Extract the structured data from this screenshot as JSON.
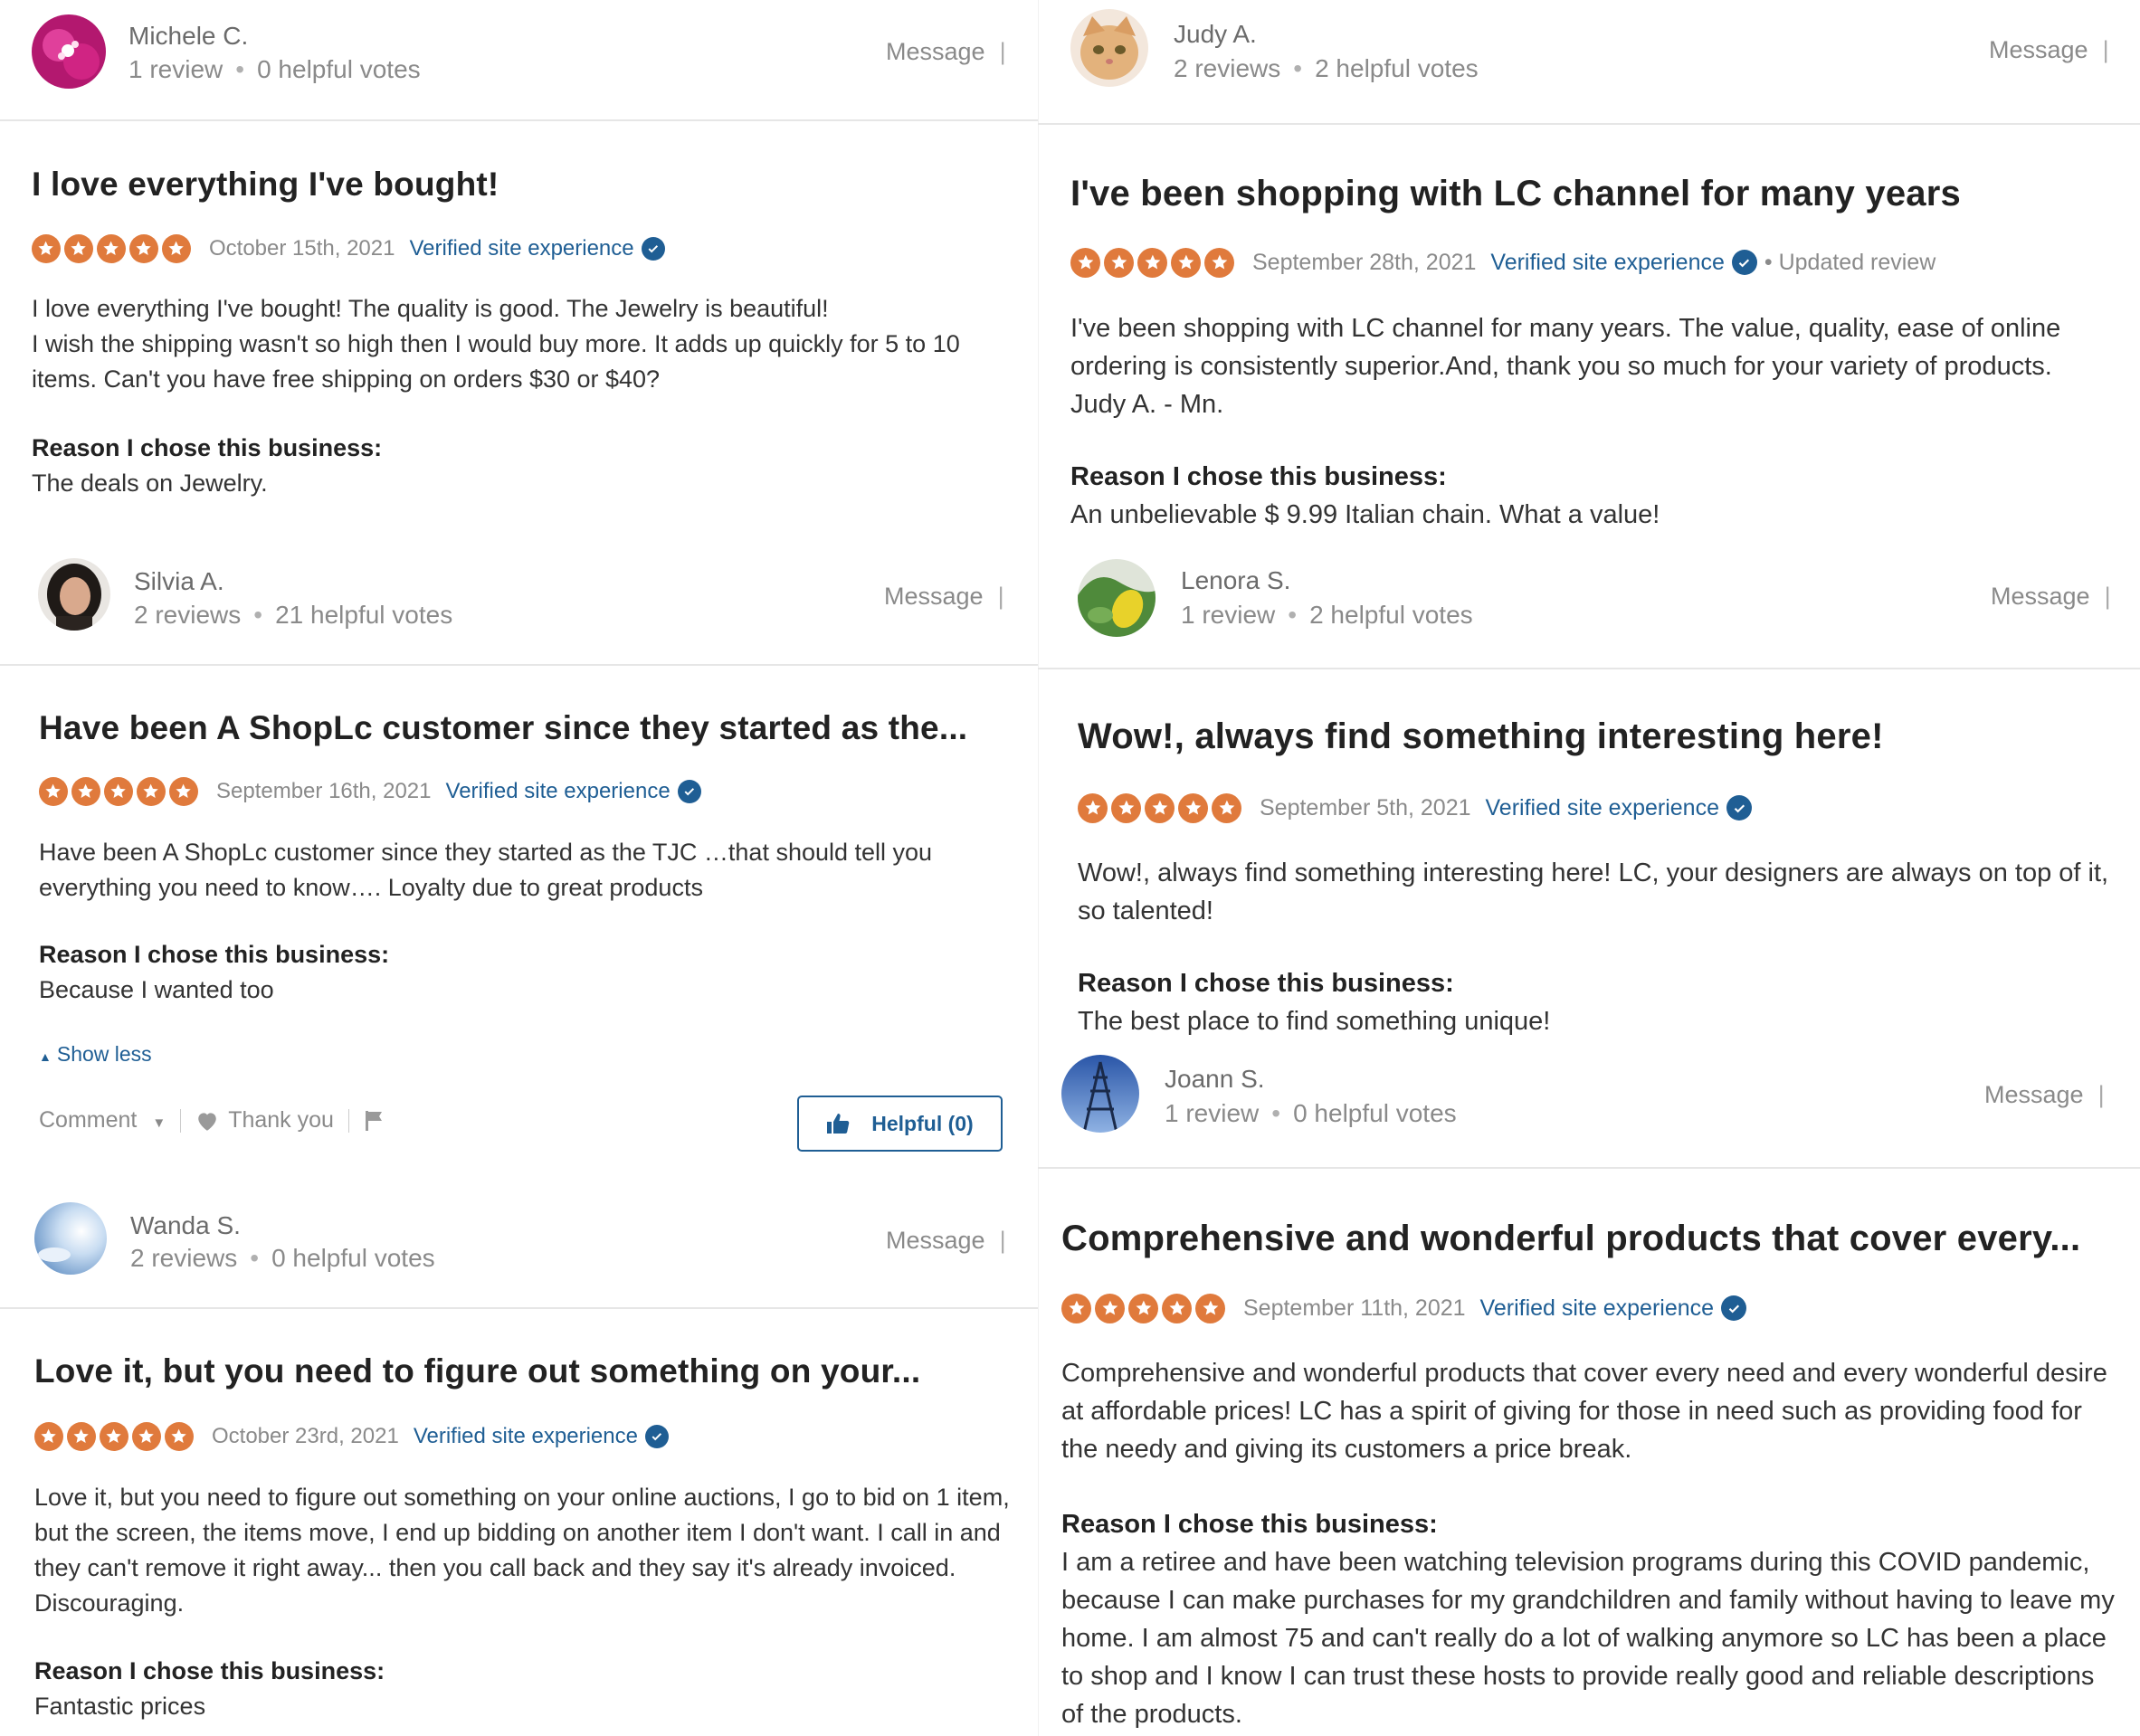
{
  "common": {
    "message_label": "Message",
    "verified_label": "Verified site experience",
    "reason_heading": "Reason I chose this business:",
    "star_color": "#e07a3c",
    "link_color": "#1f5e94"
  },
  "left": [
    {
      "reviewer": {
        "name": "Michele C.",
        "reviews": "1 review",
        "votes": "0 helpful votes",
        "avatar": "pink-flower"
      },
      "title": "I love everything I've bought!",
      "rating": 5,
      "date": "October 15th, 2021",
      "body_lines": [
        "I love everything I've bought! The quality is good. The Jewelry is beautiful!",
        "I wish the shipping wasn't so high then I would buy more. It adds up quickly for 5 to 10",
        "items. Can't you have free shipping on orders $30 or $40?"
      ],
      "reason": "The deals on Jewelry."
    },
    {
      "reviewer": {
        "name": "Silvia A.",
        "reviews": "2 reviews",
        "votes": "21 helpful votes",
        "avatar": "woman-portrait"
      },
      "title": "Have been A ShopLc customer since they started as the...",
      "rating": 5,
      "date": "September 16th, 2021",
      "body_lines": [
        "Have been A ShopLc customer since they started as the TJC …that should tell you",
        "everything you need to know…. Loyalty due to great products"
      ],
      "reason": "Because I wanted too",
      "show_less": "Show less",
      "actions": {
        "comment": "Comment",
        "thank_you": "Thank you",
        "helpful": "Helpful (0)"
      }
    },
    {
      "reviewer": {
        "name": "Wanda S.",
        "reviews": "2 reviews",
        "votes": "0 helpful votes",
        "avatar": "sky-clouds"
      },
      "title": "Love it, but you need to figure out something on your...",
      "rating": 5,
      "date": "October 23rd, 2021",
      "body_lines": [
        "Love it, but you need to figure out something on your online auctions, I go to bid on 1 item,",
        "but the screen, the items move, I end up bidding on another item I don't want. I call in and",
        "they can't remove it right away... then you call back and they say it's already invoiced.",
        "Discouraging."
      ],
      "reason": "Fantastic prices"
    }
  ],
  "right": [
    {
      "reviewer": {
        "name": "Judy A.",
        "reviews": "2 reviews",
        "votes": "2 helpful votes",
        "avatar": "cat"
      },
      "title": "I've been shopping with LC channel for many years",
      "rating": 5,
      "date": "September 28th, 2021",
      "updated": "• Updated review",
      "body_lines": [
        "I've been shopping with LC channel for many years. The value, quality, ease of online",
        "ordering is consistently superior.And, thank you so much for your variety of products.",
        "Judy A. - Mn."
      ],
      "reason": "An unbelievable $ 9.99 Italian chain. What a value!"
    },
    {
      "reviewer": {
        "name": "Lenora S.",
        "reviews": "1 review",
        "votes": "2 helpful votes",
        "avatar": "green-yellow-leaves"
      },
      "title": "Wow!, always find something interesting here!",
      "rating": 5,
      "date": "September 5th, 2021",
      "body_lines": [
        "Wow!, always find something interesting here! LC, your designers are always on top of it,",
        "so talented!"
      ],
      "reason": "The best place to find something unique!"
    },
    {
      "reviewer": {
        "name": "Joann S.",
        "reviews": "1 review",
        "votes": "0 helpful votes",
        "avatar": "tower"
      },
      "title": "Comprehensive and wonderful products that cover every...",
      "rating": 5,
      "date": "September 11th, 2021",
      "body_lines": [
        "Comprehensive and wonderful products that cover every need and every wonderful desire",
        "at affordable prices! LC has a spirit of giving for those in need such as providing food for",
        "the needy and giving its customers a price break."
      ],
      "reason_lines": [
        "I am a retiree and have been watching television programs during this COVID pandemic,",
        "because I can make purchases for my grandchildren and family without having to leave my",
        "home. I am almost 75 and can't really do a lot of walking anymore so LC has been a place",
        "to shop and I know I can trust these hosts to provide really good and reliable descriptions",
        "of the products."
      ]
    }
  ]
}
